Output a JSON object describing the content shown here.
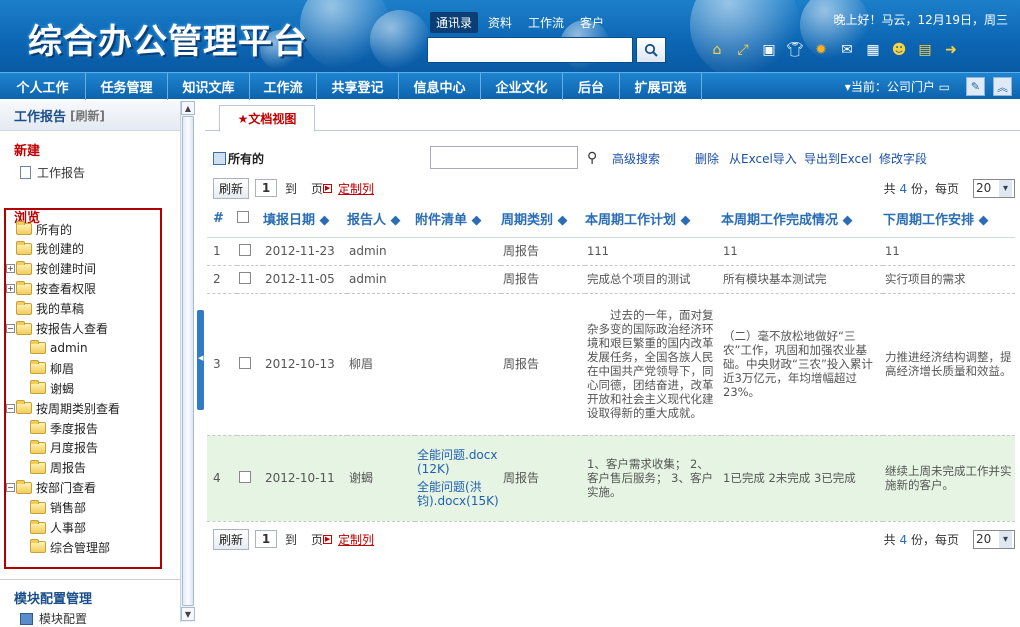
{
  "header": {
    "logo": "综合办公管理平台",
    "search_tabs": [
      "通讯录",
      "资料",
      "工作流",
      "客户"
    ],
    "search_icon": "search-icon",
    "greeting": "晚上好！马云，12月19日，周三",
    "icons": [
      "home-icon",
      "shrink-icon",
      "window-icon",
      "shirt-icon",
      "gear-icon",
      "mail-icon",
      "calendar-icon",
      "user-icon",
      "note-icon",
      "exit-icon"
    ]
  },
  "nav": {
    "items": [
      "个人工作",
      "任务管理",
      "知识文库",
      "工作流",
      "共享登记",
      "信息中心",
      "企业文化",
      "后台",
      "扩展可选"
    ],
    "current": "▾当前：公司门户",
    "buttons": [
      "edit-icon",
      "collapse-up-icon"
    ]
  },
  "sidebar": {
    "title": "工作报告",
    "refresh": "[刷新]",
    "new_label": "新建",
    "new_item": "工作报告",
    "browse_label": "浏览",
    "tree": [
      {
        "label": "所有的",
        "level": 0,
        "toggle": ""
      },
      {
        "label": "我创建的",
        "level": 0,
        "toggle": ""
      },
      {
        "label": "按创建时间",
        "level": 0,
        "toggle": "+"
      },
      {
        "label": "按查看权限",
        "level": 0,
        "toggle": "+"
      },
      {
        "label": "我的草稿",
        "level": 0,
        "toggle": ""
      },
      {
        "label": "按报告人查看",
        "level": 0,
        "toggle": "-"
      },
      {
        "label": "admin",
        "level": 1,
        "toggle": ""
      },
      {
        "label": "柳眉",
        "level": 1,
        "toggle": ""
      },
      {
        "label": "谢蝎",
        "level": 1,
        "toggle": ""
      },
      {
        "label": "按周期类别查看",
        "level": 0,
        "toggle": "-"
      },
      {
        "label": "季度报告",
        "level": 1,
        "toggle": ""
      },
      {
        "label": "月度报告",
        "level": 1,
        "toggle": ""
      },
      {
        "label": "周报告",
        "level": 1,
        "toggle": ""
      },
      {
        "label": "按部门查看",
        "level": 0,
        "toggle": "-"
      },
      {
        "label": "销售部",
        "level": 1,
        "toggle": ""
      },
      {
        "label": "人事部",
        "level": 1,
        "toggle": ""
      },
      {
        "label": "综合管理部",
        "level": 1,
        "toggle": ""
      }
    ],
    "module_title": "模块配置管理",
    "module_item": "模块配置"
  },
  "main": {
    "tab": "★文档视图",
    "all_label": "所有的",
    "search_value": "",
    "links": [
      "高级搜索",
      "删除",
      "从Excel导入",
      "导出到Excel",
      "修改字段"
    ],
    "pager": {
      "refresh": "刷新",
      "page": "1",
      "to": "到",
      "page_unit": "页",
      "custom": "定制列",
      "total_prefix": "共",
      "total": "4",
      "total_suffix": "份，每页",
      "per_page": "20"
    },
    "columns": [
      "#",
      "",
      "填报日期 ◆",
      "报告人 ◆",
      "附件清单 ◆",
      "周期类别 ◆",
      "本周期工作计划 ◆",
      "本周期工作完成情况 ◆",
      "下周期工作安排 ◆"
    ],
    "rows": [
      {
        "no": "1",
        "date": "2012-11-23",
        "reporter": "admin",
        "attachments": [],
        "cycle": "周报告",
        "plan": "111",
        "done": "11",
        "next": "11"
      },
      {
        "no": "2",
        "date": "2012-11-05",
        "reporter": "admin",
        "attachments": [],
        "cycle": "周报告",
        "plan": "完成总个项目的测试",
        "done": "所有模块基本测试完",
        "next": "实行项目的需求"
      },
      {
        "no": "3",
        "date": "2012-10-13",
        "reporter": "柳眉",
        "attachments": [],
        "cycle": "周报告",
        "plan": "　　过去的一年，面对复杂多变的国际政治经济环境和艰巨繁重的国内改革发展任务，全国各族人民在中国共产党领导下，同心同德，团结奋进，改革开放和社会主义现代化建设取得新的重大成就。",
        "done": "（二）毫不放松地做好“三农”工作，巩固和加强农业基础。中央财政“三农”投入累计近3万亿元，年均增幅超过23%。",
        "next": "力推进经济结构调整，提高经济增长质量和效益。"
      },
      {
        "no": "4",
        "date": "2012-10-11",
        "reporter": "谢蝎",
        "attachments": [
          "全能问题.docx (12K)",
          "全能问题(洪钧).docx(15K)"
        ],
        "cycle": "周报告",
        "plan": "1、客户需求收集； 2、客户售后服务； 3、客户实施。",
        "done": "1已完成 2未完成 3已完成",
        "next": "继续上周未完成工作并实施新的客户。"
      }
    ]
  }
}
